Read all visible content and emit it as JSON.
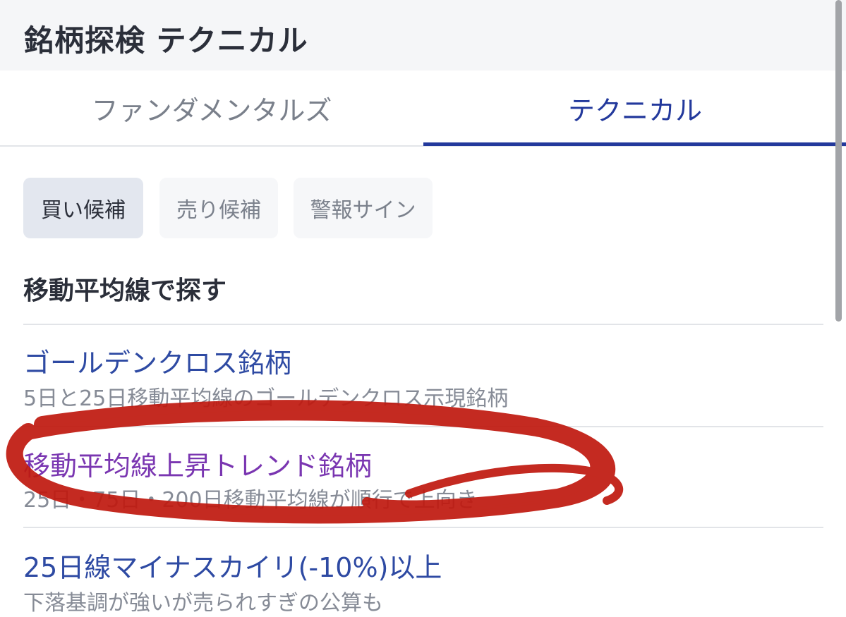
{
  "header": {
    "title": "銘柄探検 テクニカル"
  },
  "tabs": [
    {
      "label": "ファンダメンタルズ"
    },
    {
      "label": "テクニカル"
    }
  ],
  "chips": [
    {
      "label": "買い候補"
    },
    {
      "label": "売り候補"
    },
    {
      "label": "警報サイン"
    }
  ],
  "section": {
    "title": "移動平均線で探す"
  },
  "items": [
    {
      "title": "ゴールデンクロス銘柄",
      "desc": "5日と25日移動平均線のゴールデンクロス示現銘柄"
    },
    {
      "title": "移動平均線上昇トレンド銘柄",
      "desc": "25日・75日・200日移動平均線が順行で上向き"
    },
    {
      "title": "25日線マイナスカイリ(-10%)以上",
      "desc": "下落基調が強いが売られすぎの公算も"
    }
  ],
  "colors": {
    "accent": "#23399c",
    "link": "#2e4aa3",
    "visited_link": "#7a36b1",
    "annotation": "#c0190f"
  }
}
